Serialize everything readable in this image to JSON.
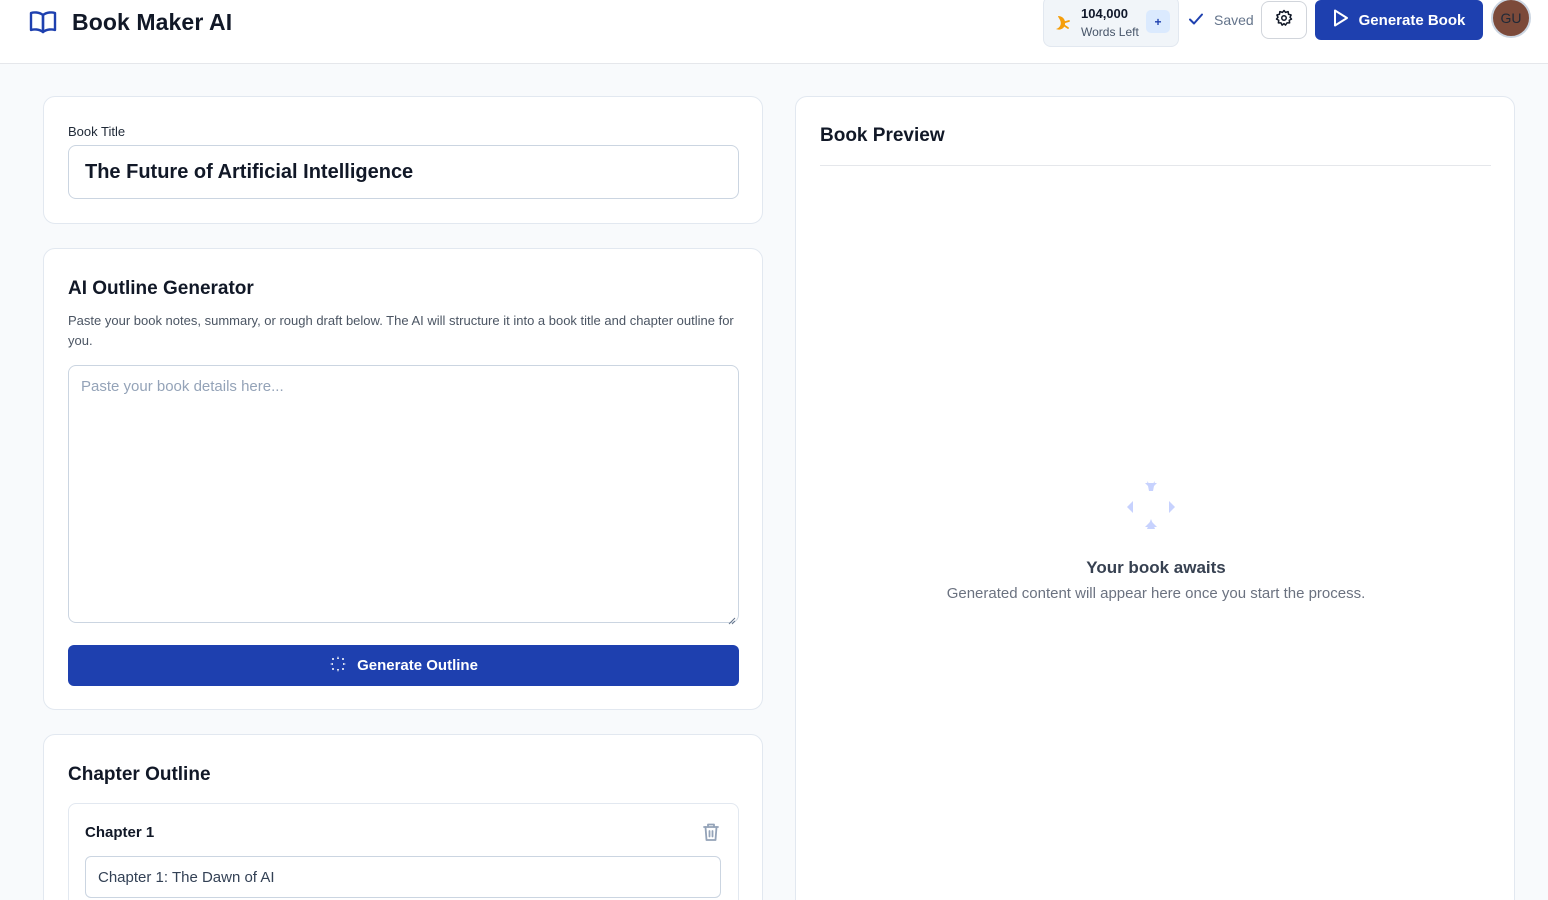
{
  "header": {
    "app_title": "Book Maker AI",
    "credits_value": "104,000",
    "credits_label": "Words Left",
    "add_credits_label": "+",
    "save_status": "Saved",
    "generate_book_label": "Generate Book",
    "avatar_initials": "GU"
  },
  "book_title_card": {
    "label": "Book Title",
    "value": "The Future of Artificial Intelligence"
  },
  "outline_generator": {
    "title": "AI Outline Generator",
    "description": "Paste your book notes, summary, or rough draft below. The AI will structure it into a book title and chapter outline for you.",
    "placeholder": "Paste your book details here...",
    "button_label": "Generate Outline"
  },
  "chapter_outline": {
    "title": "Chapter Outline",
    "chapters": [
      {
        "label": "Chapter 1",
        "title": "Chapter 1: The Dawn of AI"
      }
    ]
  },
  "preview": {
    "title": "Book Preview",
    "empty_title": "Your book awaits",
    "empty_subtitle": "Generated content will appear here once you start the process."
  },
  "colors": {
    "primary": "#1e40af",
    "accent_orange": "#f59e0b",
    "muted_icon": "#c7d2fe"
  }
}
